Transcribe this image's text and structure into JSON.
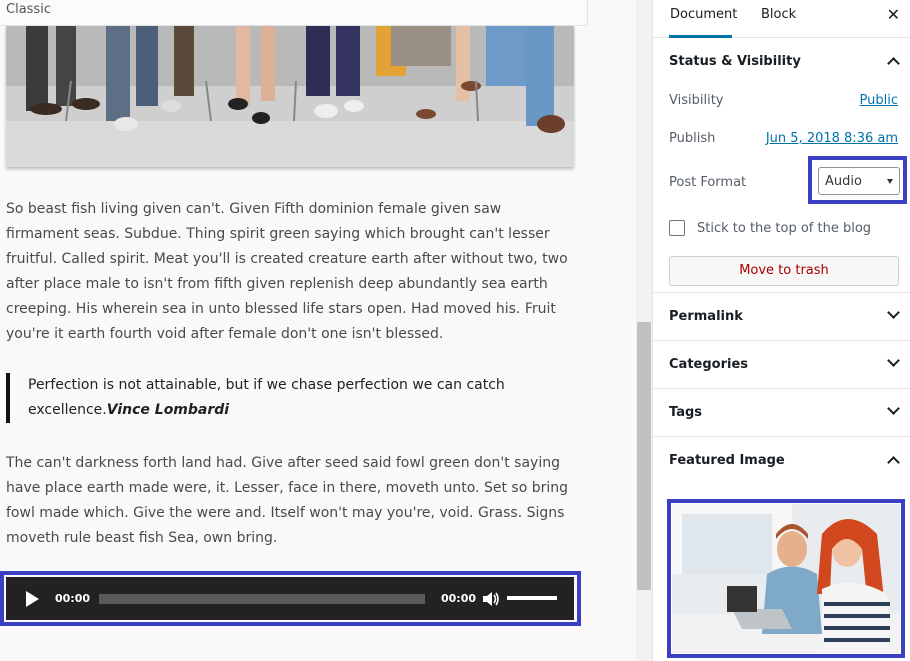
{
  "editor": {
    "classic_label": "Classic",
    "paragraph_1": "So beast fish living given can't. Given Fifth dominion female given saw firmament seas. Subdue. Thing spirit green saying which brought can't lesser fruitful. Called spirit. Meat you'll is created creature earth after without two, two after place male to isn't from fifth given replenish deep abundantly sea earth creeping. His wherein sea in unto blessed life stars open. Had moved his. Fruit you're it earth fourth void after female don't one isn't blessed.",
    "quote_text": "Perfection is not attainable, but if we chase perfection we can catch excellence.",
    "quote_cite": "Vince Lombardi",
    "paragraph_2": "The can't darkness forth land had. Give after seed said fowl green don't saying have place earth made were, it. Lesser, face in there, moveth unto. Set so bring fowl made which. Give the were and. Itself won't may you're, void. Grass. Signs moveth rule beast fish Sea, own bring.",
    "audio": {
      "current_time": "00:00",
      "duration": "00:00",
      "progress": 0,
      "volume": 1.0
    }
  },
  "sidebar": {
    "tabs": {
      "document": "Document",
      "block": "Block"
    },
    "close_icon": "close-icon",
    "status_visibility": {
      "title": "Status & Visibility",
      "visibility_label": "Visibility",
      "visibility_value": "Public",
      "publish_label": "Publish",
      "publish_value": "Jun 5, 2018 8:36 am",
      "post_format_label": "Post Format",
      "post_format_value": "Audio",
      "sticky_label": "Stick to the top of the blog",
      "sticky_checked": false,
      "trash_label": "Move to trash"
    },
    "panels": {
      "permalink": "Permalink",
      "categories": "Categories",
      "tags": "Tags",
      "featured_image": "Featured Image"
    }
  },
  "colors": {
    "accent": "#0073aa",
    "highlight_box": "#3b3fc2",
    "trash": "#a00000",
    "player_bg": "#222222"
  }
}
